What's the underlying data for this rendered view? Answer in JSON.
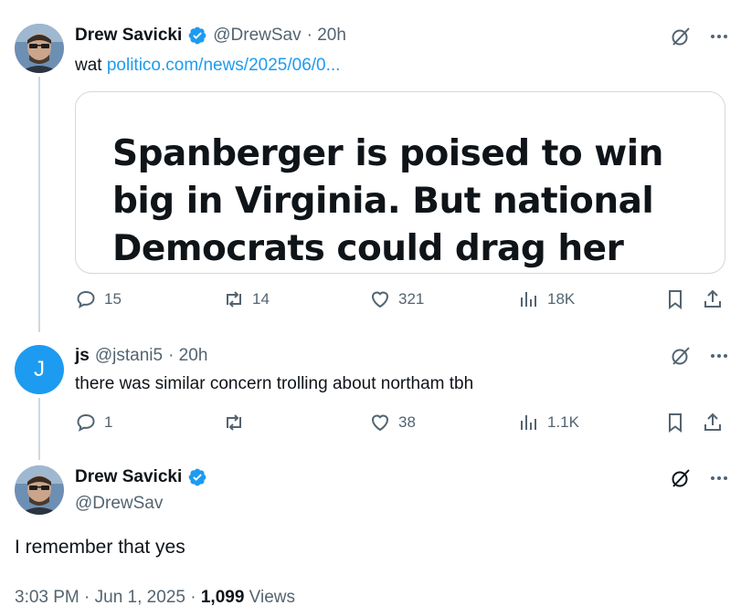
{
  "tweet1": {
    "name": "Drew Savicki",
    "handle": "@DrewSav",
    "time": "· 20h",
    "text": "wat",
    "link": "politico.com/news/2025/06/0...",
    "card_headline": "Spanberger is poised to win big in Virginia. But national Democrats could drag her down.",
    "replies": "15",
    "reposts": "14",
    "likes": "321",
    "views": "18K"
  },
  "tweet2": {
    "avatar_letter": "J",
    "name": "js",
    "handle": "@jstani5",
    "time": "· 20h",
    "text": "there was similar concern trolling about northam tbh",
    "replies": "1",
    "reposts": "",
    "likes": "38",
    "views": "1.1K"
  },
  "main_tweet": {
    "name": "Drew Savicki",
    "handle": "@DrewSav",
    "text": "I remember that yes",
    "timestamp": "3:03 PM · Jun 1, 2025 ·",
    "view_count": "1,099",
    "views_label": "Views"
  },
  "icons": {
    "grok": "grok-icon",
    "more": "more-icon",
    "reply": "reply-icon",
    "repost": "repost-icon",
    "like": "like-icon",
    "views": "views-icon",
    "bookmark": "bookmark-icon",
    "share": "share-icon",
    "verified": "verified-badge-icon"
  },
  "colors": {
    "accent": "#1d9bf0",
    "muted": "#536471",
    "text": "#0f1419",
    "line": "#cfd9de"
  }
}
